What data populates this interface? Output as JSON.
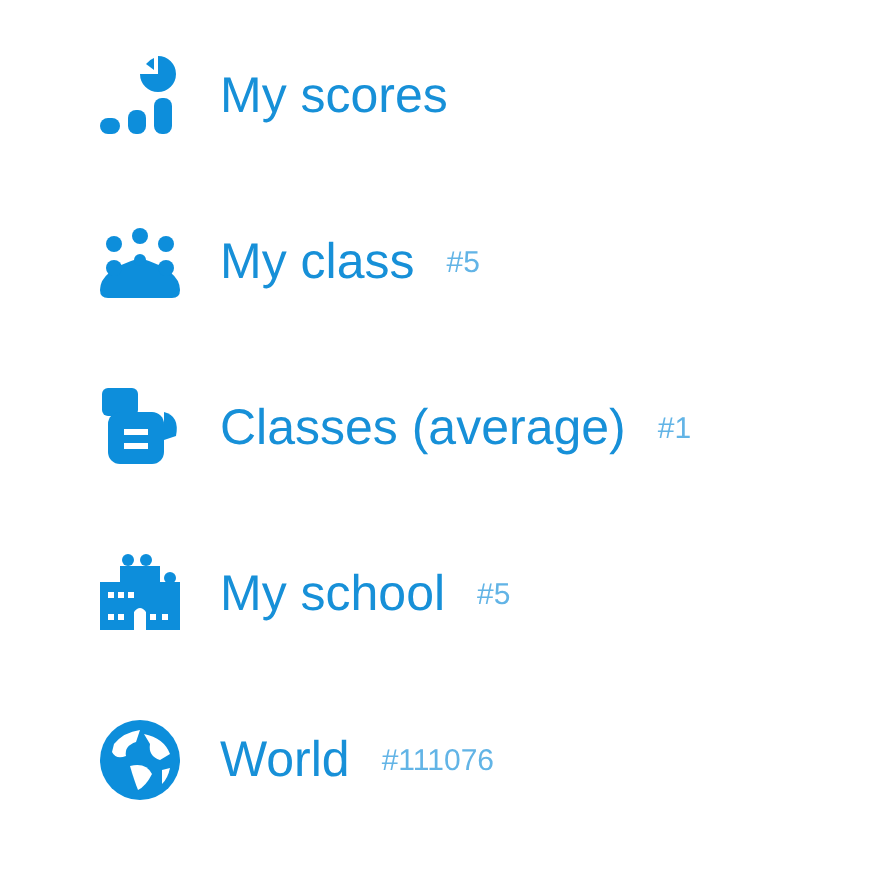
{
  "menu": [
    {
      "kind": "scores",
      "label": "My scores"
    },
    {
      "kind": "class",
      "label": "My class",
      "rank": "#5"
    },
    {
      "kind": "classes",
      "label": "Classes (average)",
      "rank": "#1"
    },
    {
      "kind": "school",
      "label": "My school",
      "rank": "#5"
    },
    {
      "kind": "world",
      "label": "World",
      "rank": "#111076"
    }
  ]
}
